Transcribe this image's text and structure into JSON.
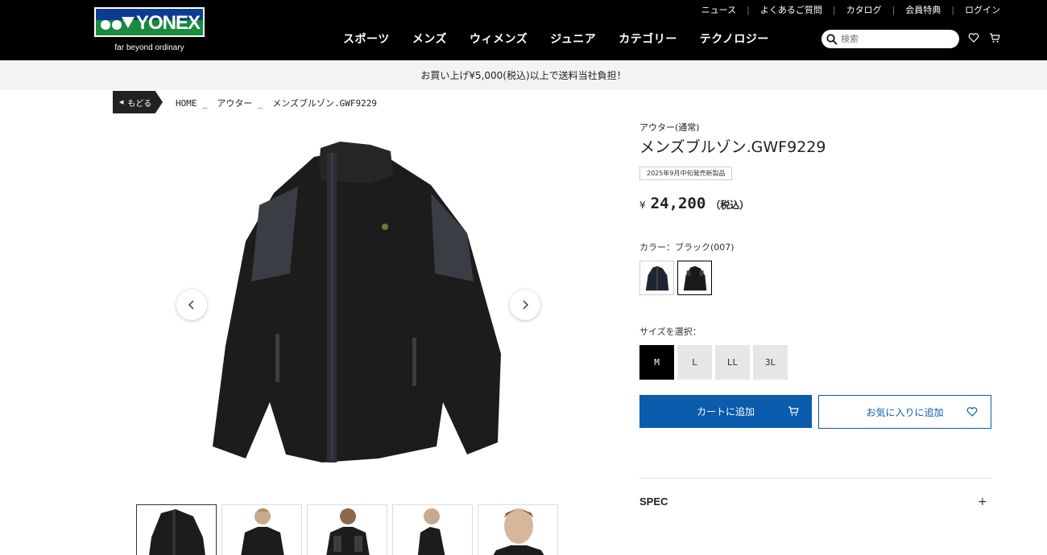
{
  "header": {
    "logo_text": "YONEX",
    "tagline": "far beyond ordinary",
    "utility_links": [
      "ニュース",
      "よくあるご質問",
      "カタログ",
      "会員特典",
      "ログイン"
    ],
    "nav": [
      "スポーツ",
      "メンズ",
      "ウィメンズ",
      "ジュニア",
      "カテゴリー",
      "テクノロジー"
    ],
    "search_placeholder": "検索"
  },
  "banner": {
    "text": "お買い上げ¥5,000(税込)以上で送料当社負担！"
  },
  "breadcrumb": {
    "back_label": "もどる",
    "items": [
      "HOME _",
      "アウター _",
      "メンズブルゾン.GWF9229"
    ]
  },
  "product": {
    "category": "アウター(通常)",
    "name": "メンズブルゾン.GWF9229",
    "release_badge": "2025年9月中旬発売新製品",
    "price_symbol": "¥",
    "price": "24,200",
    "tax_note": "（税込）",
    "color_label": "カラー：ブラック(007)",
    "colors": [
      "ネイビー",
      "ブラック"
    ],
    "size_label": "サイズを選択：",
    "sizes": [
      "M",
      "L",
      "LL",
      "3L"
    ],
    "selected_size": "M",
    "add_to_cart": "カートに追加",
    "add_to_favorites": "お気に入りに追加",
    "spec_label": "SPEC",
    "spec_toggle": "+"
  },
  "colors": {
    "accent": "#0b5cad",
    "header_bg": "#000000",
    "logo_green": "#1a8a3c"
  }
}
